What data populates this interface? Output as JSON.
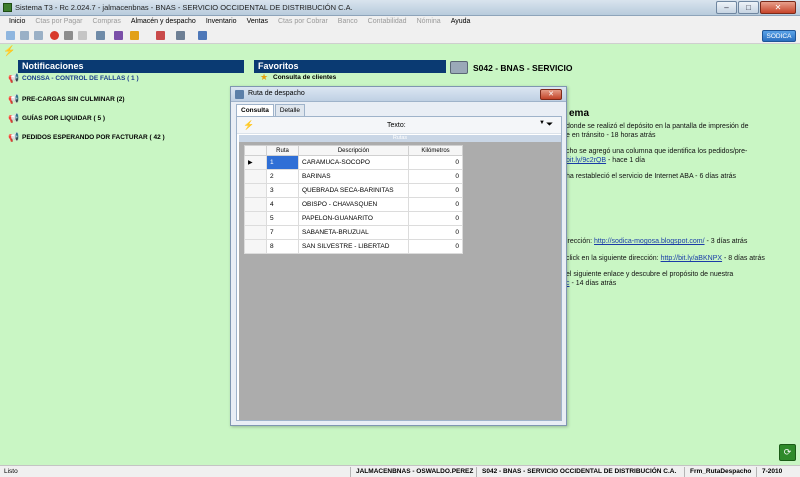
{
  "window": {
    "title": "Sistema T3  -  Rc 2.024.7  -  jalmacenbnas  -  BNAS  -  SERVICIO OCCIDENTAL DE DISTRIBUCIÓN C.A.",
    "minimize": "–",
    "maximize": "□",
    "close": "✕"
  },
  "menu": [
    {
      "label": "Inicio",
      "enabled": true
    },
    {
      "label": "Ctas por Pagar",
      "enabled": false
    },
    {
      "label": "Compras",
      "enabled": false
    },
    {
      "label": "Almacén y despacho",
      "enabled": true
    },
    {
      "label": "Inventario",
      "enabled": true
    },
    {
      "label": "Ventas",
      "enabled": true
    },
    {
      "label": "Ctas por Cobrar",
      "enabled": false
    },
    {
      "label": "Banco",
      "enabled": false
    },
    {
      "label": "Contabilidad",
      "enabled": false
    },
    {
      "label": "Nómina",
      "enabled": false
    },
    {
      "label": "Ayuda",
      "enabled": true
    }
  ],
  "toolbar": {
    "brand": "SODICA"
  },
  "notifications": {
    "header": "Notificaciones",
    "items": [
      "CONSSA - CONTROL DE FALLAS ( 1 )",
      "PRE-CARGAS SIN CULMINAR  (2)",
      "GUÍAS POR LIQUIDAR  ( 5 )",
      "PEDIDOS ESPERANDO POR FACTURAR  ( 42 )"
    ]
  },
  "favorites": {
    "header": "Favoritos",
    "items": [
      "Consulta de clientes"
    ]
  },
  "service": {
    "title": "S042 - BNAS - SERVICIO"
  },
  "news": {
    "heading": "ema",
    "lines": [
      {
        "text": " donde se realizó el depósito en la pantalla de impresión de",
        "link": "",
        "tail": ""
      },
      {
        "text": "e en tránsito - 18 horas atrás",
        "link": "",
        "tail": ""
      },
      {
        "text": "cho se agregó una columna que identifica los pedidos/pre-",
        "link": "",
        "tail": ""
      },
      {
        "text": "",
        "link": "bit.ly/9c2rQB",
        "tail": " - hace 1 día"
      },
      {
        "text": "ha restableció el servicio de Internet ABA - 6 días atrás",
        "link": "",
        "tail": ""
      },
      {
        "text": "irección: ",
        "link": "http://sodica-mogosa.blogspot.com/",
        "tail": " - 3 días atrás"
      },
      {
        "text": "click en la siguiente dirección: ",
        "link": "http://bit.ly/aBKNPX",
        "tail": " - 8 días atrás"
      },
      {
        "text": "el siguiente enlace y descubre el propósito de nuestra",
        "link": "",
        "tail": ""
      },
      {
        "text": "",
        "link": "c",
        "tail": " - 14 días atrás"
      }
    ]
  },
  "modal": {
    "title": "Ruta de despacho",
    "close": "✕",
    "tabs": [
      "Consulta",
      "Detalle"
    ],
    "filter_label": "Texto:",
    "filter_value": "",
    "grid_band": "Rutas",
    "columns": [
      "Ruta",
      "Descripción",
      "Kilómetros"
    ],
    "rows": [
      {
        "ruta": "1",
        "descripcion": "CARAMUCA-SOCOPO",
        "km": "0"
      },
      {
        "ruta": "2",
        "descripcion": "BARINAS",
        "km": "0"
      },
      {
        "ruta": "3",
        "descripcion": "QUEBRADA SECA-BARINITAS",
        "km": "0"
      },
      {
        "ruta": "4",
        "descripcion": "OBISPO - CHAVASQUEN",
        "km": "0"
      },
      {
        "ruta": "5",
        "descripcion": "PAPELON-GUANARITO",
        "km": "0"
      },
      {
        "ruta": "7",
        "descripcion": "SABANETA-BRUZUAL",
        "km": "0"
      },
      {
        "ruta": "8",
        "descripcion": "SAN SILVESTRE - LIBERTAD",
        "km": "0"
      }
    ]
  },
  "status": {
    "state": "Listo",
    "user": "JALMACENBNAS - OSWALDO.PEREZ",
    "company": "S042 - BNAS - SERVICIO OCCIDENTAL DE DISTRIBUCIÓN C.A.",
    "form": "Frm_RutaDespacho",
    "version": "7-2010"
  }
}
